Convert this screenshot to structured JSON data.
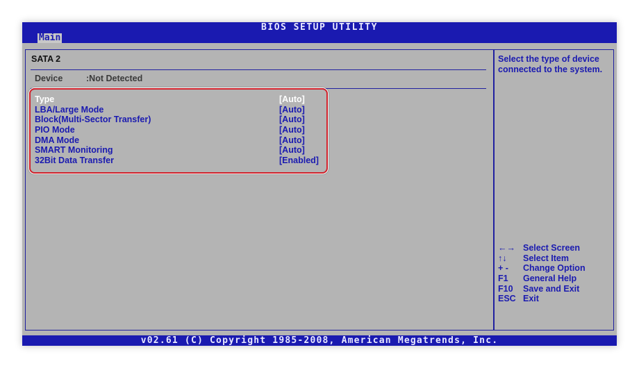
{
  "header": {
    "title": "BIOS SETUP UTILITY",
    "active_tab": "Main"
  },
  "panel": {
    "section_title": "SATA 2",
    "device_label": "Device",
    "device_value": ":Not Detected",
    "options": [
      {
        "label": "Type",
        "value": "[Auto]",
        "selected": true
      },
      {
        "label": "LBA/Large Mode",
        "value": "[Auto]"
      },
      {
        "label": "Block(Multi-Sector Transfer)",
        "value": "[Auto]"
      },
      {
        "label": "PIO Mode",
        "value": "[Auto]"
      },
      {
        "label": "DMA Mode",
        "value": "[Auto]"
      },
      {
        "label": "SMART Monitoring",
        "value": "[Auto]"
      },
      {
        "label": "32Bit Data Transfer",
        "value": "[Enabled]"
      }
    ]
  },
  "help": {
    "description": "Select the type of device connected to the system.",
    "keys": [
      {
        "key": "←→",
        "desc": "Select Screen"
      },
      {
        "key": "↑↓",
        "desc": "Select Item"
      },
      {
        "key": "+ -",
        "desc": "Change Option"
      },
      {
        "key": "F1",
        "desc": "General Help"
      },
      {
        "key": "F10",
        "desc": "Save and Exit"
      },
      {
        "key": "ESC",
        "desc": "Exit"
      }
    ]
  },
  "footer": {
    "copyright": "v02.61 (C) Copyright 1985-2008, American Megatrends, Inc."
  },
  "colors": {
    "bar_blue": "#1a1ab0",
    "screen_gray": "#b4b4b4",
    "selected_text": "#ffffff",
    "highlight_red": "#d0202a"
  }
}
